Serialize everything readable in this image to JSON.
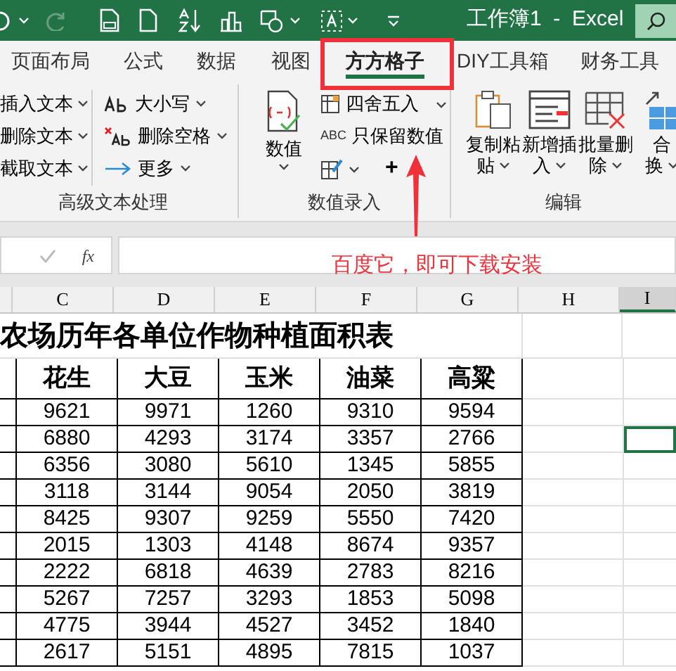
{
  "title_bar": {
    "title": "工作簿1  -  Excel"
  },
  "tabs": [
    {
      "label": "页面布局",
      "selected": false
    },
    {
      "label": "公式",
      "selected": false
    },
    {
      "label": "数据",
      "selected": false
    },
    {
      "label": "视图",
      "selected": false
    },
    {
      "label": "方方格子",
      "selected": true
    },
    {
      "label": "DIY工具箱",
      "selected": false
    },
    {
      "label": "财务工具",
      "selected": false
    }
  ],
  "ribbon": {
    "text_group": {
      "label": "高级文本处理",
      "items": [
        {
          "label": "插入文本"
        },
        {
          "label": "删除文本"
        },
        {
          "label": "截取文本"
        }
      ],
      "items_2": [
        {
          "kind": "case",
          "label": "大小写"
        },
        {
          "kind": "trim",
          "label": "删除空格"
        },
        {
          "kind": "more",
          "label": "更多"
        }
      ]
    },
    "number_group": {
      "label": "数值录入",
      "big_button": "数值",
      "items": [
        {
          "kind": "round",
          "label": "四舍五入"
        },
        {
          "kind": "keep",
          "label": "只保留数值",
          "icon_text": "ABC"
        }
      ],
      "plus": "+"
    },
    "edit_group": {
      "label": "编辑",
      "buttons": [
        {
          "kind": "copy",
          "line1": "复制粘",
          "line2": "贴"
        },
        {
          "kind": "insert",
          "line1": "新增插",
          "line2": "入"
        },
        {
          "kind": "delete",
          "line1": "批量删",
          "line2": "除"
        },
        {
          "kind": "merge",
          "line1": "合",
          "line2": "换"
        }
      ]
    }
  },
  "formula_bar": {
    "fx": "fx"
  },
  "annotation": {
    "text": "百度它，即可下载安装"
  },
  "sheet": {
    "columns": [
      {
        "label": "C",
        "selected": false
      },
      {
        "label": "D",
        "selected": false
      },
      {
        "label": "E",
        "selected": false
      },
      {
        "label": "F",
        "selected": false
      },
      {
        "label": "G",
        "selected": false
      },
      {
        "label": "H",
        "selected": false
      },
      {
        "label": "I",
        "selected": true
      }
    ],
    "title": "农场历年各单位作物种植面积表",
    "header": [
      "花生",
      "大豆",
      "玉米",
      "油菜",
      "高粱"
    ],
    "rows": [
      {
        "selected": false,
        "cells": [
          "9621",
          "9971",
          "1260",
          "9310",
          "9594"
        ]
      },
      {
        "selected": true,
        "cells": [
          "6880",
          "4293",
          "3174",
          "3357",
          "2766"
        ]
      },
      {
        "selected": false,
        "cells": [
          "6356",
          "3080",
          "5610",
          "1345",
          "5855"
        ]
      },
      {
        "selected": false,
        "cells": [
          "3118",
          "3144",
          "9054",
          "2050",
          "3819"
        ]
      },
      {
        "selected": false,
        "cells": [
          "8425",
          "9307",
          "9259",
          "5550",
          "7420"
        ]
      },
      {
        "selected": false,
        "cells": [
          "2015",
          "1303",
          "4148",
          "8674",
          "9357"
        ]
      },
      {
        "selected": false,
        "cells": [
          "2222",
          "6818",
          "4639",
          "2783",
          "8216"
        ]
      },
      {
        "selected": false,
        "cells": [
          "5267",
          "7257",
          "3293",
          "1853",
          "5098"
        ]
      },
      {
        "selected": false,
        "cells": [
          "4775",
          "3944",
          "4527",
          "3452",
          "1840"
        ]
      },
      {
        "selected": false,
        "cells": [
          "2617",
          "5151",
          "4895",
          "7815",
          "1037"
        ]
      }
    ]
  }
}
